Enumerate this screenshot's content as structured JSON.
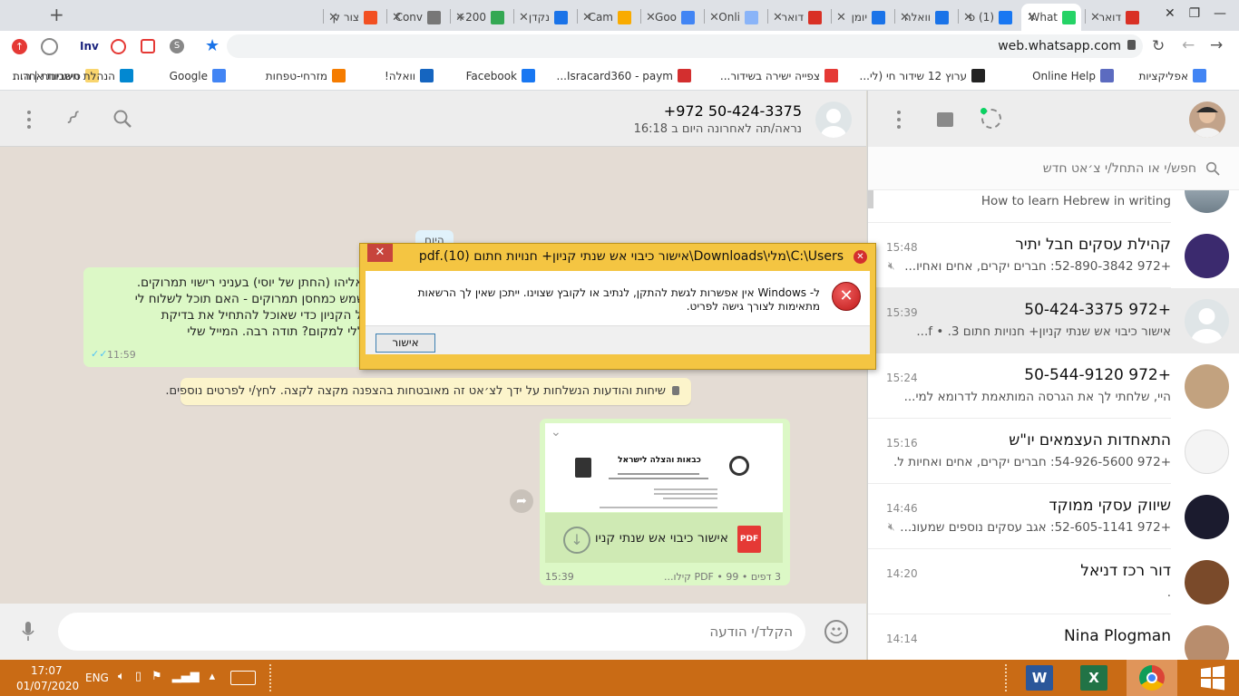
{
  "browser": {
    "tabs": [
      {
        "title": "דואר",
        "icon": "gmail-icon",
        "color": "#d93025",
        "active": false
      },
      {
        "title": "What",
        "icon": "whatsapp-icon",
        "color": "#25d366",
        "active": true
      },
      {
        "title": "(1) פ",
        "icon": "facebook-icon",
        "color": "#1877f2",
        "active": false
      },
      {
        "title": "וואלה",
        "icon": "walla-icon",
        "color": "#1a73e8",
        "active": false
      },
      {
        "title": "יומן",
        "icon": "calendar-icon",
        "color": "#1a73e8",
        "active": false
      },
      {
        "title": "דואר",
        "icon": "gmail-icon",
        "color": "#d93025",
        "active": false
      },
      {
        "title": "Onli",
        "icon": "online-icon",
        "color": "#8ab4f8",
        "active": false
      },
      {
        "title": "Goo",
        "icon": "translate-icon",
        "color": "#4285f4",
        "active": false
      },
      {
        "title": "Cam",
        "icon": "campaign-icon",
        "color": "#f9ab00",
        "active": false
      },
      {
        "title": "נקדן",
        "icon": "nakdan-icon",
        "color": "#1a73e8",
        "active": false
      },
      {
        "title": "200+",
        "icon": "px-icon",
        "color": "#34a853",
        "active": false
      },
      {
        "title": "Conv",
        "icon": "convert-icon",
        "color": "#777777",
        "active": false
      },
      {
        "title": "צור ק",
        "icon": "microsoft-icon",
        "color": "#f25022",
        "active": false
      }
    ],
    "url": "web.whatsapp.com",
    "ext_inv": "Inv",
    "bookmarks": [
      {
        "label": "אפליקציות",
        "color": "#4285f4"
      },
      {
        "label": "Online Help",
        "color": "#5c6bc0"
      },
      {
        "label": "ערוץ 12 שידור חי (לי...",
        "color": "#222222"
      },
      {
        "label": "צפייה ישירה בשידור...",
        "color": "#e53935"
      },
      {
        "label": "Isracard360 - paym...",
        "color": "#d32f2f"
      },
      {
        "label": "Facebook",
        "color": "#1877f2"
      },
      {
        "label": "וואלה!",
        "color": "#1565c0"
      },
      {
        "label": "מזרחי-טפחות",
        "color": "#f57c00"
      },
      {
        "label": "Google",
        "color": "#4285f4"
      },
      {
        "label": "הנהלת חשבונות | ה...",
        "color": "#0288d1"
      }
    ],
    "bookmarks_more": "»",
    "other_bookmarks": "סימניות אחרות"
  },
  "chat": {
    "contact_name": "+972 50-424-3375",
    "last_seen": "נראה/תה לאחרונה היום ב 16:18",
    "date_chip": "היום",
    "sent_message": {
      "lines": [
        "של אליהו (החתן של יוסי) בעניני רישוי תמרוקים.",
        "ד לשמש כמחסן תמרוקים - האם תוכל לשלוח לי",
        "ת של הקניון כדי שאוכל להתחיל את בדיקת",
        "ם כללי למקום? תודה רבה. המייל שלי"
      ],
      "time": "11:59"
    },
    "encryption_notice": "שיחות והודעות הנשלחות על ידך לצ׳אט זה מאובטחות בהצפנה מקצה לקצה. לחץ/י לפרטים נוספים.",
    "document": {
      "filename": "אישור כיבוי אש שנתי קניו",
      "meta": "3 דפים • PDF • 99 קילו...",
      "time": "15:39",
      "badge": "PDF",
      "preview_title": "כבאות והצלה לישראל"
    },
    "composer_placeholder": "הקלד/י הודעה"
  },
  "sidebar": {
    "search_placeholder": "חפש/י או התחל/י צ׳אט חדש",
    "chats": [
      {
        "name": "",
        "time": "",
        "preview": "How to learn Hebrew in writing",
        "muted": false,
        "selected": false
      },
      {
        "name": "קהילת עסקים חבל יתיר",
        "time": "15:48",
        "preview": "+972 52-890-3842: חברים יקרים, אחים ואחיו...",
        "muted": true,
        "selected": false
      },
      {
        "name": "+972 50-424-3375",
        "time": "15:39",
        "preview": "אישור כיבוי אש שנתי קניון+ חנויות חתום 3. • f...",
        "muted": false,
        "selected": true
      },
      {
        "name": "+972 50-544-9120",
        "time": "15:24",
        "preview": "היי, שלחתי לך את הגרסה המותאמת לדרומא למי...",
        "muted": false,
        "selected": false
      },
      {
        "name": "התאחדות העצמאים יו\"ש",
        "time": "15:16",
        "preview": "+972 54-926-5600: חברים יקרים, אחים ואחיות ל...",
        "muted": false,
        "selected": false
      },
      {
        "name": "שיווק עסקי ממוקד",
        "time": "14:46",
        "preview": "+972 52-605-1141: אגב עסקים נוספים שמעונ...",
        "muted": true,
        "selected": false
      },
      {
        "name": "דור רכז דניאל",
        "time": "14:20",
        "preview": ".",
        "muted": false,
        "selected": false
      },
      {
        "name": "Nina Plogman",
        "time": "14:14",
        "preview": "",
        "muted": false,
        "selected": false
      }
    ]
  },
  "dialog": {
    "title": "C:\\Users\\מלי\\Downloads\\אישור כיבוי אש שנתי קניון+ חנויות חתום  (10).pdf",
    "message": "ל- Windows אין אפשרות לגשת להתקן, לנתיב או לקובץ שצוינו. ייתכן שאין לך הרשאות מתאימות לצורך גישה לפריט.",
    "ok_label": "אישור",
    "close_label": "✕"
  },
  "taskbar": {
    "time": "17:07",
    "date": "01/07/2020",
    "lang": "ENG"
  }
}
